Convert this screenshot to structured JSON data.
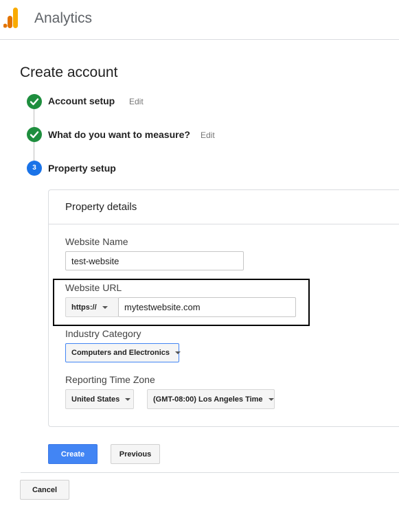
{
  "header": {
    "app_title": "Analytics"
  },
  "page_title": "Create account",
  "steps": [
    {
      "label": "Account setup",
      "edit": "Edit",
      "status": "done"
    },
    {
      "label": "What do you want to measure?",
      "edit": "Edit",
      "status": "done"
    },
    {
      "label": "Property setup",
      "number": "3",
      "status": "active"
    }
  ],
  "property": {
    "section_title": "Property details",
    "website_name": {
      "label": "Website Name",
      "value": "test-website"
    },
    "website_url": {
      "label": "Website URL",
      "protocol": "https://",
      "value": "mytestwebsite.com"
    },
    "industry": {
      "label": "Industry Category",
      "value": "Computers and Electronics"
    },
    "time_zone": {
      "label": "Reporting Time Zone",
      "country": "United States",
      "zone": "(GMT-08:00) Los Angeles Time"
    }
  },
  "actions": {
    "create": "Create",
    "previous": "Previous",
    "cancel": "Cancel"
  },
  "colors": {
    "step_done": "#1e8e3e",
    "step_active": "#1a73e8",
    "primary_button": "#4285f4",
    "logo_orange": "#f9ab00",
    "logo_dark_orange": "#e37400"
  }
}
